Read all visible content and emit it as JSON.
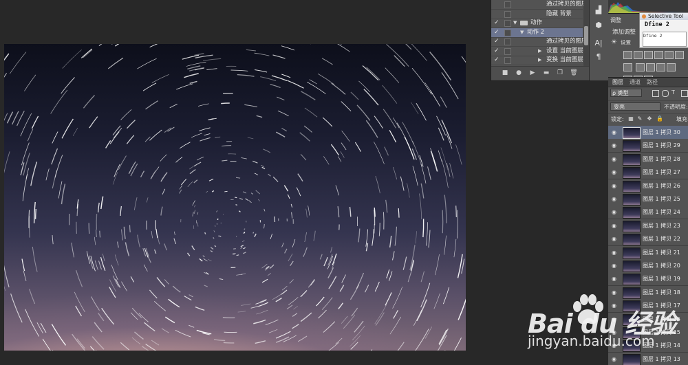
{
  "actions_panel": {
    "rows": [
      {
        "checked": false,
        "label": "通过拷贝的图层",
        "indent": 2,
        "kind": "step"
      },
      {
        "checked": false,
        "label": "隐藏 背景",
        "indent": 2,
        "kind": "step"
      },
      {
        "checked": true,
        "label": "动作",
        "indent": 0,
        "kind": "set",
        "expanded": true
      },
      {
        "checked": true,
        "label": "动作 2",
        "indent": 1,
        "kind": "action",
        "expanded": true,
        "selected": true
      },
      {
        "checked": true,
        "label": "通过拷贝的图层",
        "indent": 2,
        "kind": "step"
      },
      {
        "checked": true,
        "label": "设置 当前图层",
        "indent": 2,
        "kind": "step-collapsed"
      },
      {
        "checked": true,
        "label": "变换 当前图层",
        "indent": 2,
        "kind": "step-collapsed"
      }
    ],
    "footer_buttons": [
      "stop-icon",
      "record-icon",
      "play-icon",
      "new-set-icon",
      "new-action-icon",
      "delete-icon"
    ]
  },
  "tool_strip": [
    "histogram-icon",
    "3d-icon",
    "character-icon",
    "paragraph-icon"
  ],
  "adjustments": {
    "tab": "调整",
    "add_label": "添加调整"
  },
  "plugin_window": {
    "title": "Selective Tool",
    "name": "Dfine 2",
    "sub": "Dfine 2",
    "setting": "设置"
  },
  "layers_panel": {
    "tabs": [
      "图层",
      "通道",
      "路径"
    ],
    "filter": "ρ 类型",
    "blend_mode": "变亮",
    "opacity_label": "不透明度:",
    "lock_label": "锁定:",
    "fill_label": "填充:",
    "layers": [
      {
        "name": "图层 1 拷贝 30",
        "visible": true,
        "selected": true
      },
      {
        "name": "图层 1 拷贝 29",
        "visible": true
      },
      {
        "name": "图层 1 拷贝 28",
        "visible": true
      },
      {
        "name": "图层 1 拷贝 27",
        "visible": true
      },
      {
        "name": "图层 1 拷贝 26",
        "visible": true
      },
      {
        "name": "图层 1 拷贝 25",
        "visible": true
      },
      {
        "name": "图层 1 拷贝 24",
        "visible": true
      },
      {
        "name": "图层 1 拷贝 23",
        "visible": true
      },
      {
        "name": "图层 1 拷贝 22",
        "visible": true
      },
      {
        "name": "图层 1 拷贝 21",
        "visible": true
      },
      {
        "name": "图层 1 拷贝 20",
        "visible": true
      },
      {
        "name": "图层 1 拷贝 19",
        "visible": true
      },
      {
        "name": "图层 1 拷贝 18",
        "visible": true
      },
      {
        "name": "图层 1 拷贝 17",
        "visible": true
      },
      {
        "name": "图层 1 拷贝 16",
        "visible": true
      },
      {
        "name": "图层 1 拷贝 15",
        "visible": true
      },
      {
        "name": "图层 1 拷贝 14",
        "visible": true
      },
      {
        "name": "图层 1 拷贝 13",
        "visible": true
      }
    ]
  },
  "watermark": {
    "brand": "Bai du 经验",
    "url": "jingyan.baidu.com"
  },
  "colors": {
    "panel_bg": "#535353",
    "workspace_bg": "#282828",
    "selection": "#6c7590"
  }
}
